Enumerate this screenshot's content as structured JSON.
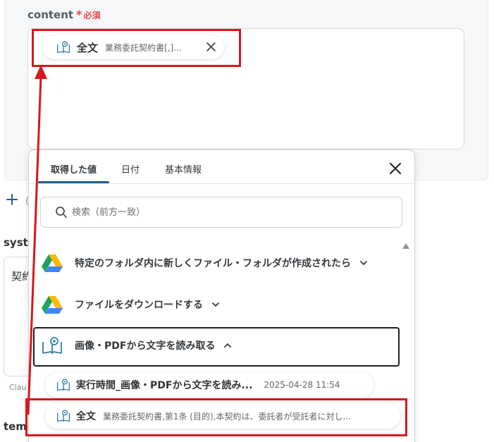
{
  "field": {
    "label": "content",
    "required_star": "*",
    "required_text": "必須"
  },
  "content_chip": {
    "title": "全文",
    "subtitle": "業務委託契約書[,]..."
  },
  "background_fragments": {
    "o": "(",
    "syst": "syst",
    "kei": "契約",
    "clau": "Clau",
    "tem": "tem"
  },
  "popup": {
    "tabs": [
      {
        "label": "取得した値",
        "active": true
      },
      {
        "label": "日付",
        "active": false
      },
      {
        "label": "基本情報",
        "active": false
      }
    ],
    "search": {
      "placeholder": "検索（前方一致）",
      "value": ""
    },
    "sections": [
      {
        "label": "特定のフォルダ内に新しくファイル・フォルダが作成されたら",
        "icon": "google-drive-icon",
        "expanded": false
      },
      {
        "label": "ファイルをダウンロードする",
        "icon": "google-drive-icon",
        "expanded": false
      },
      {
        "label": "画像・PDFから文字を読み取る",
        "icon": "ocr-book-icon",
        "expanded": true
      }
    ],
    "items": [
      {
        "title": "実行時間_画像・PDFから文字を読み...",
        "date": "2025-04-28 11:54"
      },
      {
        "title": "全文",
        "subtitle": "業務委託契約書,第1条 (目的),本契約は、委託者が受託者に対し..."
      }
    ]
  },
  "colors": {
    "accent": "#1f5f8b",
    "required": "#e5484d",
    "annotation_red": "#d9161c",
    "drive_green": "#1ea362",
    "drive_yellow": "#ffba00",
    "drive_blue": "#4285f4",
    "book_icon": "#2f7fa8"
  }
}
